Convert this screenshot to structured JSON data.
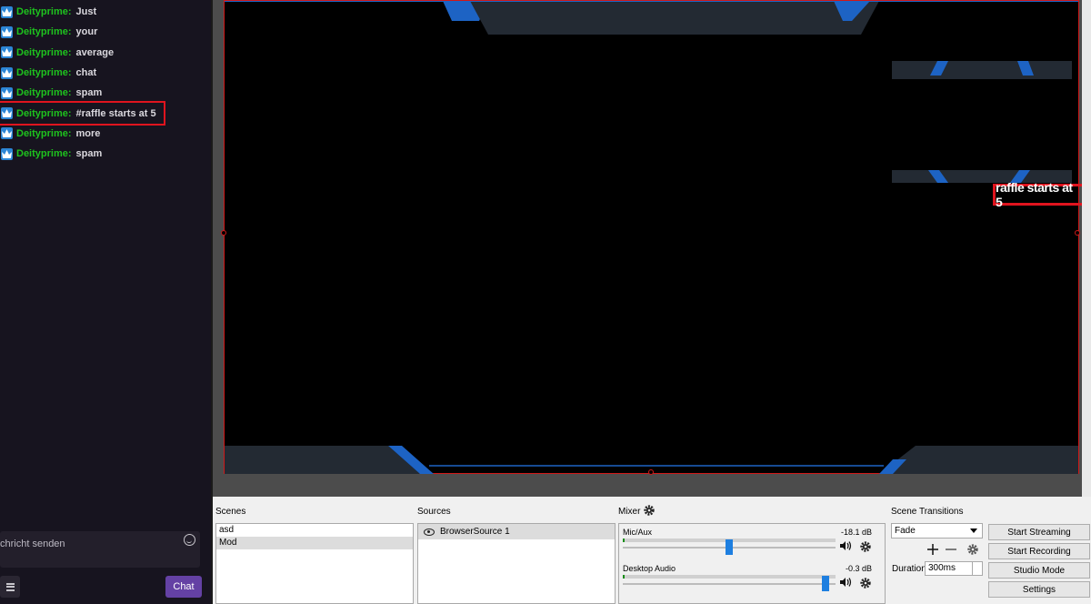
{
  "chat": {
    "messages": [
      {
        "user": "Deityprime",
        "text": "Just"
      },
      {
        "user": "Deityprime",
        "text": "your"
      },
      {
        "user": "Deityprime",
        "text": "average"
      },
      {
        "user": "Deityprime",
        "text": "chat"
      },
      {
        "user": "Deityprime",
        "text": "spam"
      },
      {
        "user": "Deityprime",
        "text": "#raffle starts at 5"
      },
      {
        "user": "Deityprime",
        "text": "more"
      },
      {
        "user": "Deityprime",
        "text": "spam"
      }
    ],
    "input_placeholder": "chricht senden",
    "send_label": "Chat",
    "badge_icon": "crown-icon",
    "user_color": "#1ec21e"
  },
  "preview": {
    "overlay_text": "raffle starts at 5",
    "highlight_color": "#e0141e"
  },
  "obs": {
    "scenes": {
      "title": "Scenes",
      "items": [
        "asd",
        "Mod"
      ],
      "selected": "Mod"
    },
    "sources": {
      "title": "Sources",
      "items": [
        "BrowserSource 1"
      ]
    },
    "mixer": {
      "title": "Mixer",
      "channels": [
        {
          "name": "Mic/Aux",
          "db": "-18.1 dB",
          "level": 0.5
        },
        {
          "name": "Desktop Audio",
          "db": "-0.3 dB",
          "level": 0.97
        }
      ]
    },
    "transitions": {
      "title": "Scene Transitions",
      "selected": "Fade",
      "duration_label": "Duration",
      "duration_value": "300ms"
    },
    "controls": {
      "start_streaming": "Start Streaming",
      "start_recording": "Start Recording",
      "studio_mode": "Studio Mode",
      "settings": "Settings"
    }
  }
}
